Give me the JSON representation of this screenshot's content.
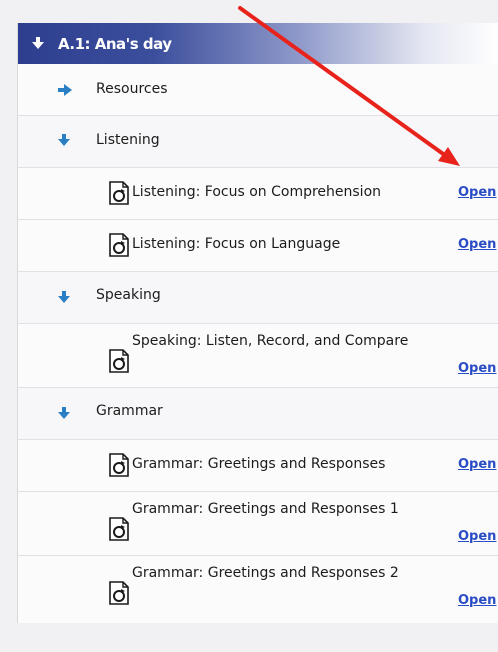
{
  "unit": {
    "title": "A.1: Ana's day",
    "icon": "arrow-down-icon"
  },
  "sections": {
    "resources": {
      "label": "Resources",
      "icon": "arrow-right-icon"
    },
    "listening": {
      "label": "Listening",
      "icon": "arrow-down-icon"
    },
    "speaking": {
      "label": "Speaking",
      "icon": "arrow-down-icon"
    },
    "grammar": {
      "label": "Grammar",
      "icon": "arrow-down-icon"
    }
  },
  "activities": {
    "listening_1": {
      "label": "Listening: Focus on Comprehension",
      "link": "Open"
    },
    "listening_2": {
      "label": "Listening: Focus on Language",
      "link": "Open"
    },
    "speaking_1": {
      "label": "Speaking: Listen, Record, and Compare",
      "link": "Open"
    },
    "grammar_1": {
      "label": "Grammar: Greetings and Responses",
      "link": "Open"
    },
    "grammar_2": {
      "label": "Grammar: Greetings and Responses 1",
      "link": "Open"
    },
    "grammar_3": {
      "label": "Grammar: Greetings and Responses 2",
      "link": "Open"
    }
  },
  "colors": {
    "header": "#2d3e8e",
    "section_arrow": "#2a7fc4",
    "link": "#2a4cc4",
    "annotation_arrow": "#e8231c"
  }
}
